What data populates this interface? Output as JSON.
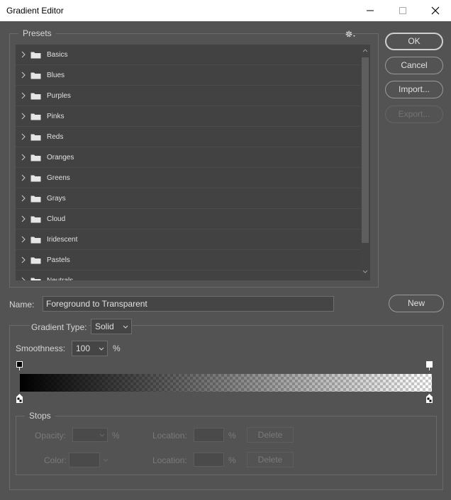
{
  "window": {
    "title": "Gradient Editor"
  },
  "presets": {
    "legend": "Presets",
    "items": [
      "Basics",
      "Blues",
      "Purples",
      "Pinks",
      "Reds",
      "Oranges",
      "Greens",
      "Grays",
      "Cloud",
      "Iridescent",
      "Pastels",
      "Neutrals"
    ]
  },
  "buttons": {
    "ok": "OK",
    "cancel": "Cancel",
    "import": "Import...",
    "export": "Export...",
    "new": "New"
  },
  "name": {
    "label": "Name:",
    "value": "Foreground to Transparent"
  },
  "gradient": {
    "type_label": "Gradient Type:",
    "type_value": "Solid",
    "smoothness_label": "Smoothness:",
    "smoothness_value": "100",
    "smoothness_unit": "%"
  },
  "stops": {
    "legend": "Stops",
    "opacity_label": "Opacity:",
    "color_label": "Color:",
    "location_label": "Location:",
    "percent": "%",
    "delete_label": "Delete"
  },
  "icons": {
    "minimize": "minimize-icon",
    "maximize": "maximize-icon",
    "close": "close-icon",
    "gear": "gear-icon",
    "folder": "folder-icon",
    "chevron": "chevron-right-icon"
  },
  "colors": {
    "background": "#535353",
    "list_bg": "#424242",
    "gradient_start": "#000000"
  }
}
